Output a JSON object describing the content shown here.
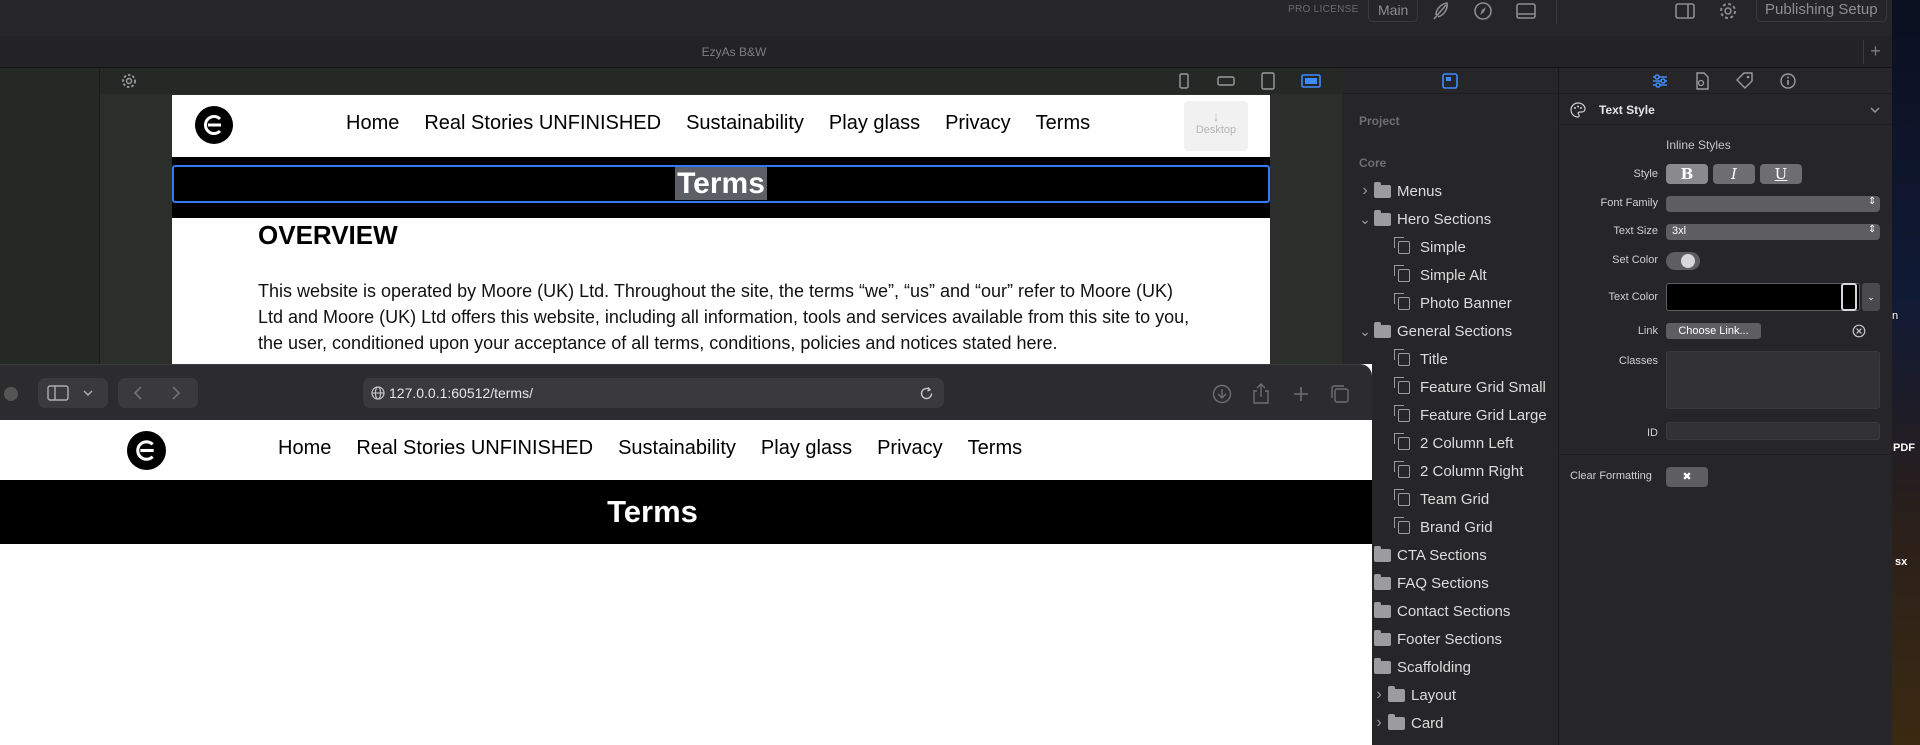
{
  "topbar": {
    "license": "PRO LICENSE",
    "main_button": "Main",
    "publish_button": "Publishing Setup",
    "icons": [
      "feather-icon",
      "compass-icon",
      "drawer-icon",
      "sidebar-icon",
      "gear-icon"
    ]
  },
  "window_title": "EzyAs B&W",
  "editor": {
    "nav": [
      "Home",
      "Real Stories UNFINISHED",
      "Sustainability",
      "Play glass",
      "Privacy",
      "Terms"
    ],
    "desktop_label": "Desktop",
    "hero_title": "Terms",
    "heading": "OVERVIEW",
    "body_text": "This website is operated by Moore (UK) Ltd. Throughout the site, the terms “we”, “us” and “our” refer to Moore (UK) Ltd and Moore (UK) Ltd offers this website, including all information, tools and services available from this site to you, the user, conditioned upon your acceptance of all terms, conditions, policies and notices stated here."
  },
  "browser": {
    "url": "127.0.0.1:60512/terms/",
    "nav": [
      "Home",
      "Real Stories UNFINISHED",
      "Sustainability",
      "Play glass",
      "Privacy",
      "Terms"
    ],
    "hero_title": "Terms"
  },
  "project_panel": {
    "project_label": "Project",
    "core_label": "Core",
    "tree": [
      {
        "label": "Menus",
        "type": "folder",
        "indent": 0,
        "chevron": "right"
      },
      {
        "label": "Hero Sections",
        "type": "folder",
        "indent": 0,
        "chevron": "down"
      },
      {
        "label": "Simple",
        "type": "page",
        "indent": 1
      },
      {
        "label": "Simple Alt",
        "type": "page",
        "indent": 1
      },
      {
        "label": "Photo Banner",
        "type": "page",
        "indent": 1
      },
      {
        "label": "General Sections",
        "type": "folder",
        "indent": 0,
        "chevron": "down"
      },
      {
        "label": "Title",
        "type": "page",
        "indent": 1
      },
      {
        "label": "Feature Grid Small",
        "type": "page",
        "indent": 1
      },
      {
        "label": "Feature Grid Large",
        "type": "page",
        "indent": 1
      },
      {
        "label": "2 Column Left",
        "type": "page",
        "indent": 1
      },
      {
        "label": "2 Column Right",
        "type": "page",
        "indent": 1
      },
      {
        "label": "Team Grid",
        "type": "page",
        "indent": 1
      },
      {
        "label": "Brand Grid",
        "type": "page",
        "indent": 1
      },
      {
        "label": "CTA Sections",
        "type": "folder",
        "indent": 0
      },
      {
        "label": "FAQ Sections",
        "type": "folder",
        "indent": 0
      },
      {
        "label": "Contact Sections",
        "type": "folder",
        "indent": 0
      },
      {
        "label": "Footer Sections",
        "type": "folder",
        "indent": 0
      },
      {
        "label": "Scaffolding",
        "type": "folder",
        "indent": 0
      },
      {
        "label": "Layout",
        "type": "folder",
        "indent": 1,
        "chevron": "right"
      },
      {
        "label": "Card",
        "type": "folder",
        "indent": 1,
        "chevron": "right"
      }
    ]
  },
  "inspector": {
    "section_title": "Text Style",
    "inline_styles": "Inline Styles",
    "style_label": "Style",
    "style_buttons": [
      "B",
      "I",
      "U"
    ],
    "font_family_label": "Font Family",
    "font_family_value": "",
    "text_size_label": "Text Size",
    "text_size_value": "3xl",
    "set_color_label": "Set Color",
    "set_color_on": false,
    "text_color_label": "Text Color",
    "text_color": "#000000",
    "link_label": "Link",
    "link_button": "Choose Link...",
    "classes_label": "Classes",
    "id_label": "ID",
    "clear_formatting_label": "Clear Formatting",
    "clear_formatting_button": "✖"
  },
  "desktop_edge": {
    "fragments": [
      "PDF",
      "n",
      "sx"
    ]
  },
  "colors": {
    "selection": "#2e7bf6",
    "active_tab": "#3d8bff"
  }
}
